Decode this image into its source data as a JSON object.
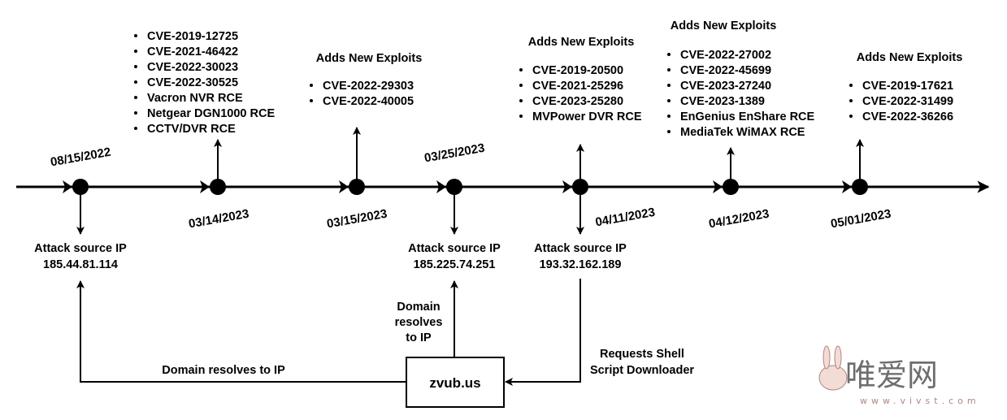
{
  "events": [
    {
      "date": "08/15/2022",
      "below": {
        "label": "Attack source IP",
        "ip": "185.44.81.114"
      }
    },
    {
      "date": "03/14/2023",
      "exploits": [
        "CVE-2019-12725",
        "CVE-2021-46422",
        "CVE-2022-30023",
        "CVE-2022-30525",
        "Vacron NVR RCE",
        "Netgear DGN1000 RCE",
        "CCTV/DVR RCE"
      ]
    },
    {
      "date": "03/15/2023",
      "title": "Adds New Exploits",
      "exploits": [
        "CVE-2022-29303",
        "CVE-2022-40005"
      ]
    },
    {
      "date": "03/25/2023",
      "below": {
        "label": "Attack source IP",
        "ip": "185.225.74.251"
      }
    },
    {
      "date": "04/11/2023",
      "title": "Adds New Exploits",
      "exploits": [
        "CVE-2019-20500",
        "CVE-2021-25296",
        "CVE-2023-25280",
        "MVPower DVR RCE"
      ],
      "below": {
        "label": "Attack source IP",
        "ip": "193.32.162.189"
      }
    },
    {
      "date": "04/12/2023",
      "title": "Adds New Exploits",
      "exploits": [
        "CVE-2022-27002",
        "CVE-2022-45699",
        "CVE-2023-27240",
        "CVE-2023-1389",
        "EnGenius EnShare RCE",
        "MediaTek WiMAX RCE"
      ]
    },
    {
      "date": "05/01/2023",
      "title": "Adds New Exploits",
      "exploits": [
        "CVE-2019-17621",
        "CVE-2022-31499",
        "CVE-2022-36266"
      ]
    }
  ],
  "domain_box": "zvub.us",
  "edges": {
    "left": "Domain resolves to IP",
    "middle": [
      "Domain",
      "resolves",
      "to IP"
    ],
    "right": [
      "Requests Shell",
      "Script Downloader"
    ]
  },
  "watermark": {
    "text": "唯爱网",
    "url": "www.vivst.com",
    "color": "#555555",
    "accent": "#a0706a"
  }
}
